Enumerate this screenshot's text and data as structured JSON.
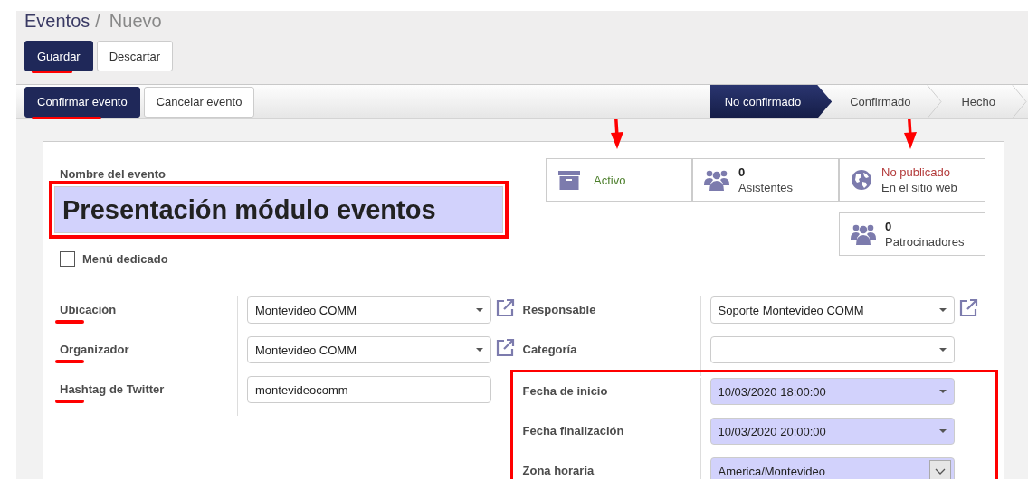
{
  "breadcrumb": {
    "parent": "Eventos",
    "separator": "/",
    "current": "Nuevo"
  },
  "actions": [
    {
      "label": "Guardar",
      "primary": true,
      "underlined": true
    },
    {
      "label": "Descartar",
      "primary": false,
      "underlined": false
    }
  ],
  "status_buttons": [
    {
      "label": "Confirmar evento",
      "primary": true,
      "underlined": true
    },
    {
      "label": "Cancelar evento",
      "primary": false,
      "underlined": false
    }
  ],
  "stages": [
    {
      "label": "No confirmado",
      "selected": true
    },
    {
      "label": "Confirmado",
      "selected": false
    },
    {
      "label": "Hecho",
      "selected": false
    }
  ],
  "stat_buttons": [
    {
      "kind": "toggle",
      "label": "Activo",
      "on": true,
      "arrow": true
    },
    {
      "kind": "counter",
      "count": "0",
      "label": "Asistentes",
      "arrow": false
    },
    {
      "kind": "website",
      "status": "No publicado",
      "label": "En el sitio web",
      "published": false,
      "arrow": true
    },
    {
      "kind": "counter",
      "count": "0",
      "label": "Patrocinadores",
      "arrow": false
    }
  ],
  "title": {
    "label": "Nombre del evento",
    "value": "Presentación módulo eventos",
    "required": true,
    "boxed": true
  },
  "dedicated_menu": {
    "label": "Menú dedicado",
    "checked": false
  },
  "groups": [
    {
      "sections": [
        {
          "boxed": false,
          "fields": [
            {
              "label": "Ubicación",
              "underlined": true,
              "kind": "many2one",
              "value": "Montevideo COMM",
              "required": false
            },
            {
              "label": "Organizador",
              "underlined": true,
              "kind": "many2one",
              "value": "Montevideo COMM",
              "required": false
            },
            {
              "label": "Hashtag de Twitter",
              "underlined": true,
              "kind": "text",
              "value": "montevideocomm",
              "required": false
            }
          ]
        }
      ]
    },
    {
      "sections": [
        {
          "boxed": false,
          "fields": [
            {
              "label": "Responsable",
              "underlined": false,
              "kind": "many2one",
              "value": "Soporte Montevideo COMM",
              "required": false
            },
            {
              "label": "Categoría",
              "underlined": false,
              "kind": "select",
              "required": false
            }
          ]
        },
        {
          "boxed": true,
          "fields": [
            {
              "label": "Fecha de inicio",
              "underlined": false,
              "kind": "datetime",
              "value": "10/03/2020 18:00:00",
              "required": true
            },
            {
              "label": "Fecha finalización",
              "underlined": false,
              "kind": "datetime",
              "value": "10/03/2020 20:00:00",
              "required": true
            },
            {
              "label": "Zona horaria",
              "underlined": false,
              "kind": "selection",
              "value": "America/Montevideo",
              "required": true
            }
          ]
        }
      ]
    }
  ]
}
